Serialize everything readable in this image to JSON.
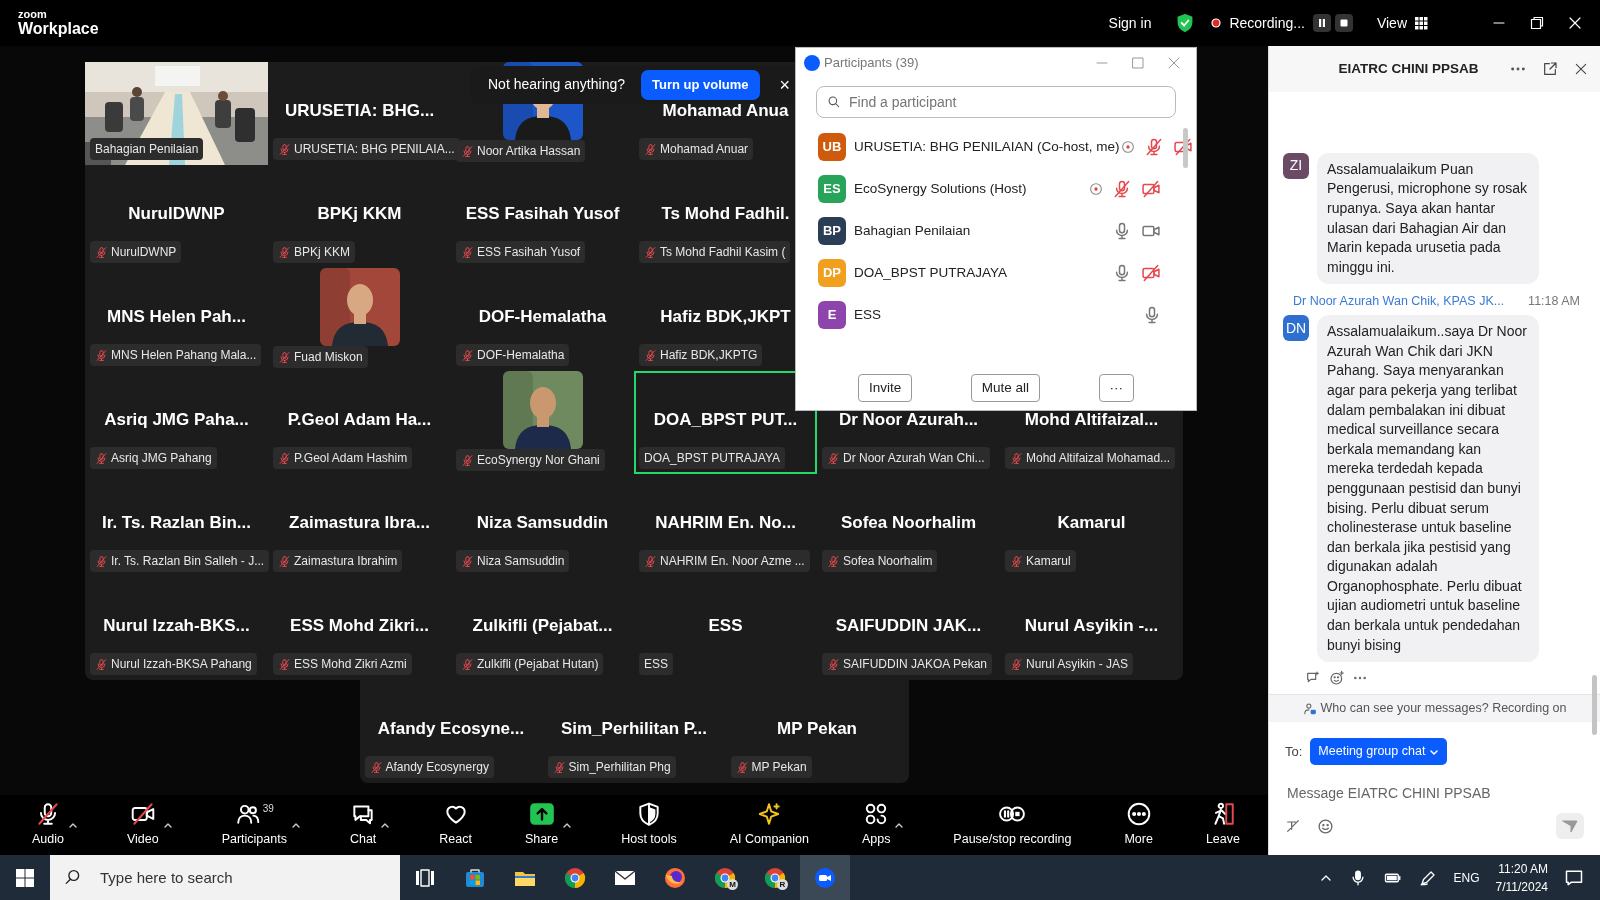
{
  "title_bar": {
    "logo_small": "zoom",
    "logo": "Workplace",
    "sign_in": "Sign in",
    "recording": "Recording...",
    "view": "View"
  },
  "gallery": {
    "rows": [
      [
        {
          "kind": "video",
          "label": "Bahagian Penilaian",
          "muted": false,
          "speaking": false
        },
        {
          "kind": "name",
          "display": "URUSETIA: BHG...",
          "label": "URUSETIA: BHG PENILAIA...",
          "muted": true,
          "speaking": false
        },
        {
          "label": "Noor Artika Hassan",
          "muted": true,
          "speaking": false
        },
        {
          "kind": "name",
          "display": "Mohamad Anua",
          "label": "Mohamad Anuar",
          "muted": true,
          "speaking": false
        }
      ],
      [
        {
          "kind": "name",
          "display": "NurulDWNP",
          "label": "NurulDWNP",
          "muted": true,
          "speaking": false
        },
        {
          "kind": "name",
          "display": "BPKj KKM",
          "label": "BPKj KKM",
          "muted": true,
          "speaking": false
        },
        {
          "kind": "name",
          "display": "ESS Fasihah Yusof",
          "label": "ESS Fasihah Yusof",
          "muted": true,
          "speaking": false
        },
        {
          "kind": "name",
          "display": "Ts Mohd Fadhil.",
          "label": "Ts Mohd Fadhil Kasim (",
          "muted": true,
          "speaking": false
        }
      ],
      [
        {
          "kind": "name",
          "display": "MNS Helen Pah...",
          "label": "MNS Helen Pahang Mala...",
          "muted": true,
          "speaking": false
        },
        {
          "label": "Fuad Miskon",
          "muted": true,
          "speaking": false
        },
        {
          "kind": "name",
          "display": "DOF-Hemalatha",
          "label": "DOF-Hemalatha",
          "muted": true,
          "speaking": false
        },
        {
          "kind": "name",
          "display": "Hafiz BDK,JKPT",
          "label": "Hafiz BDK,JKPTG",
          "muted": true,
          "speaking": false
        }
      ],
      [
        {
          "kind": "name",
          "display": "Asriq JMG Paha...",
          "label": "Asriq JMG Pahang",
          "muted": true,
          "speaking": false
        },
        {
          "kind": "name",
          "display": "P.Geol Adam Ha...",
          "label": "P.Geol Adam Hashim",
          "muted": true,
          "speaking": false
        },
        {
          "label": "EcoSynergy Nor Ghani",
          "muted": true,
          "speaking": false
        },
        {
          "kind": "name",
          "display": "DOA_BPST PUT...",
          "label": "DOA_BPST PUTRAJAYA",
          "muted": false,
          "speaking": true
        },
        {
          "kind": "name",
          "display": "Dr Noor Azurah...",
          "label": "Dr Noor Azurah Wan Chi...",
          "muted": true,
          "speaking": false
        },
        {
          "kind": "name",
          "display": "Mohd Altifaizal...",
          "label": "Mohd Altifaizal Mohamad...",
          "muted": true,
          "speaking": false
        }
      ],
      [
        {
          "kind": "name",
          "display": "Ir. Ts. Razlan Bin...",
          "label": "Ir. Ts. Razlan Bin Salleh - J...",
          "muted": true,
          "speaking": false
        },
        {
          "kind": "name",
          "display": "Zaimastura Ibra...",
          "label": "Zaimastura Ibrahim",
          "muted": true,
          "speaking": false
        },
        {
          "kind": "name",
          "display": "Niza Samsuddin",
          "label": "Niza Samsuddin",
          "muted": true,
          "speaking": false
        },
        {
          "kind": "name",
          "display": "NAHRIM En. No...",
          "label": "NAHRIM En. Noor Azme ...",
          "muted": true,
          "speaking": false
        },
        {
          "kind": "name",
          "display": "Sofea Noorhalim",
          "label": "Sofea Noorhalim",
          "muted": true,
          "speaking": false
        },
        {
          "kind": "name",
          "display": "Kamarul",
          "label": "Kamarul",
          "muted": true,
          "speaking": false
        }
      ],
      [
        {
          "kind": "name",
          "display": "Nurul Izzah-BKS...",
          "label": "Nurul Izzah-BKSA Pahang",
          "muted": true,
          "speaking": false
        },
        {
          "kind": "name",
          "display": "ESS Mohd Zikri...",
          "label": "ESS Mohd Zikri Azmi",
          "muted": true,
          "speaking": false
        },
        {
          "kind": "name",
          "display": "Zulkifli (Pejabat...",
          "label": "Zulkifli (Pejabat Hutan)",
          "muted": true,
          "speaking": false
        },
        {
          "kind": "name",
          "display": "ESS",
          "label": "ESS",
          "muted": false,
          "speaking": false
        },
        {
          "kind": "name",
          "display": "SAIFUDDIN JAK...",
          "label": "SAIFUDDIN JAKOA Pekan",
          "muted": true,
          "speaking": false
        },
        {
          "kind": "name",
          "display": "Nurul Asyikin -...",
          "label": "Nurul Asyikin - JAS",
          "muted": true,
          "speaking": false
        }
      ]
    ],
    "extra_row": [
      {
        "kind": "name",
        "display": "Afandy Ecosyne...",
        "label": "Afandy Ecosynergy",
        "muted": true,
        "speaking": false
      },
      {
        "kind": "name",
        "display": "Sim_Perhilitan P...",
        "label": "Sim_Perhilitan Phg",
        "muted": true,
        "speaking": false
      },
      {
        "kind": "name",
        "display": "MP Pekan",
        "label": "MP Pekan",
        "muted": true,
        "speaking": false
      }
    ]
  },
  "toast": {
    "text": "Not hearing anything?",
    "button": "Turn up volume",
    "close": "×"
  },
  "participants_panel": {
    "title": "Participants (39)",
    "search_placeholder": "Find a participant",
    "participants": [
      {
        "initials": "UB",
        "color": "#cf5a0c",
        "name": "URUSETIA: BHG PENILAIAN (Co-host, me)",
        "recording": true,
        "muted": true,
        "camera_off": true
      },
      {
        "initials": "ES",
        "color": "#27a35a",
        "name": "EcoSynergy Solutions (Host)",
        "recording": true,
        "muted": true,
        "camera_off": true
      },
      {
        "initials": "BP",
        "color": "#2c3e55",
        "name": "Bahagian Penilaian",
        "recording": false,
        "muted": false,
        "camera_off": false
      },
      {
        "initials": "DP",
        "color": "#f0a01e",
        "name": "DOA_BPST PUTRAJAYA",
        "recording": false,
        "muted": false,
        "camera_off": true
      },
      {
        "initials": "E",
        "color": "#8e44ad",
        "name": "ESS",
        "recording": false,
        "muted": false
      }
    ],
    "buttons": [
      "Invite",
      "Mute all"
    ],
    "more": "···"
  },
  "chat": {
    "title": "EIATRC CHINI PPSAB",
    "messages": [
      {
        "initials": "ZI",
        "color": "#6b4a66",
        "text": "Assalamualaikum Puan Pengerusi, microphone sy rosak rupanya. Saya akan hantar ulasan dari Bahagian Air dan Marin kepada urusetia pada minggu ini."
      },
      {
        "sender": "Dr Noor Azurah Wan Chik, KPAS JK...",
        "time": "11:18 AM",
        "initials": "DN",
        "color": "#2f6fd0",
        "text": "Assalamualaikum..saya Dr Noor Azurah Wan Chik dari JKN Pahang. Saya menyarankan agar para pekerja yang terlibat dalam pembalakan ini dibuat medical surveillance secara berkala memandang kan mereka terdedah kepada penggunaan pestisid dan bunyi bising. Perlu dibuat serum cholinesterase untuk baseline dan berkala jika pestisid yang digunakan adalah Organophosphate. Perlu dibuat ujian audiometri untuk baseline dan berkala untuk pendedahan bunyi bising"
      }
    ],
    "notice": "Who can see your messages? Recording on",
    "to_label": "To:",
    "recipient": "Meeting group chat",
    "placeholder": "Message EIATRC CHINI PPSAB"
  },
  "toolbar": [
    {
      "label": "Audio",
      "off": true,
      "menu": true
    },
    {
      "label": "Video",
      "off": true,
      "menu": true
    },
    {
      "label": "Participants",
      "count": "39",
      "off": false,
      "menu": true
    },
    {
      "label": "Chat",
      "off": false,
      "menu": true
    },
    {
      "label": "React",
      "off": false,
      "menu": false
    },
    {
      "label": "Share",
      "off": false,
      "menu": true
    },
    {
      "label": "Host tools",
      "off": false,
      "menu": false
    },
    {
      "label": "AI Companion",
      "off": false,
      "menu": false
    },
    {
      "label": "Apps",
      "off": false,
      "menu": true
    },
    {
      "label": "Pause/stop recording",
      "off": false,
      "menu": false
    },
    {
      "label": "More",
      "off": false,
      "menu": false
    },
    {
      "label": "Leave",
      "off": false,
      "menu": false
    }
  ],
  "taskbar": {
    "search_placeholder": "Type here to search",
    "apps": [
      {
        "active": false
      },
      {
        "active": false
      },
      {
        "active": false
      },
      {
        "active": false
      },
      {
        "active": false
      },
      {
        "active": false
      },
      {
        "active": false,
        "badge": "M"
      },
      {
        "active": false,
        "badge": "R"
      },
      {
        "active": true
      }
    ],
    "language": "ENG",
    "time": "11:20 AM",
    "date": "7/11/2024"
  }
}
